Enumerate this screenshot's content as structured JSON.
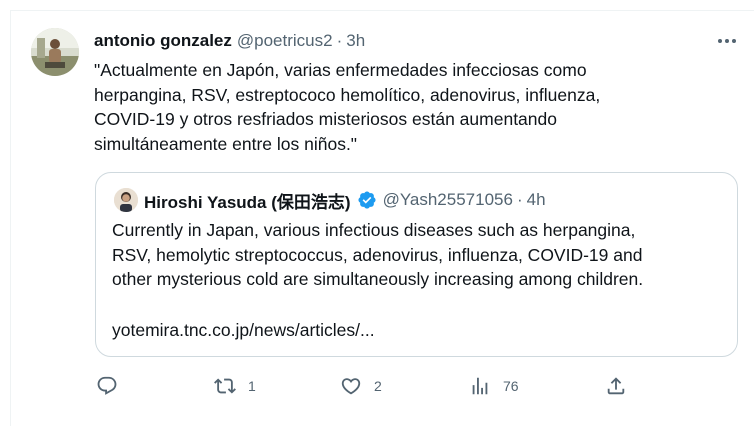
{
  "tweet": {
    "author_name": "antonio gonzalez",
    "author_handle": "@poetricus2",
    "separator": "·",
    "time": "3h",
    "text_lines": [
      "\"Actualmente en Japón, varias enfermedades infecciosas como",
      "herpangina, RSV, estreptococo hemolítico, adenovirus, influenza,",
      "COVID-19 y otros resfriados misteriosos están aumentando",
      "simultáneamente entre los niños.\""
    ]
  },
  "quote": {
    "author_name": "Hiroshi Yasuda (保田浩志)",
    "author_handle": "@Yash25571056",
    "separator": "·",
    "time": "4h",
    "text_lines": [
      "Currently in Japan, various infectious diseases such as herpangina,",
      "RSV, hemolytic streptococcus, adenovirus, influenza, COVID-19 and",
      "other mysterious cold are simultaneously increasing among children."
    ],
    "link": "yotemira.tnc.co.jp/news/articles/..."
  },
  "actions": {
    "reply_count": "",
    "retweet_count": "1",
    "like_count": "2",
    "views_count": "76"
  },
  "colors": {
    "text": "#0f1419",
    "muted": "#536471",
    "border": "#cfd9de",
    "verified": "#1d9bf0"
  },
  "icons": [
    "more-icon",
    "verified-badge-icon",
    "reply-icon",
    "retweet-icon",
    "like-icon",
    "views-icon",
    "share-icon"
  ]
}
